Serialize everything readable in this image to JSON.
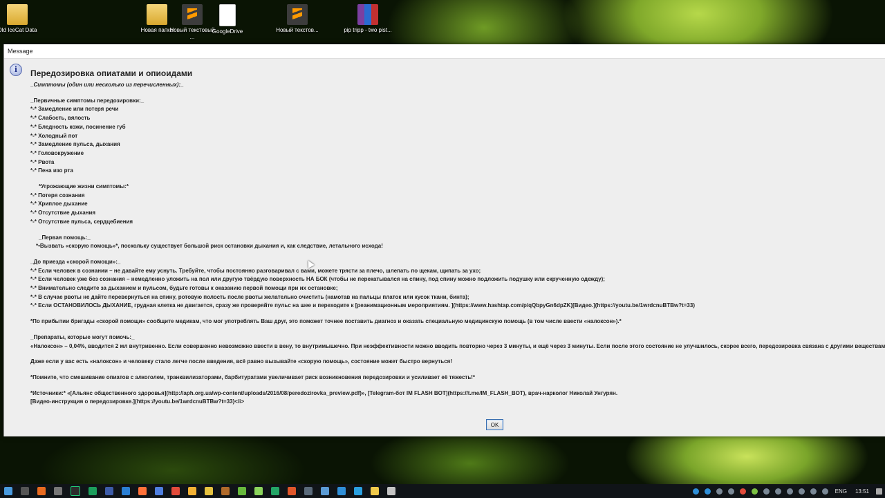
{
  "desktop": {
    "icons": [
      {
        "label": "Old IceCat Data",
        "type": "folder-icon"
      },
      {
        "label": "Новая папка",
        "type": "folder-icon"
      },
      {
        "label": "Новый текстовый ...",
        "type": "sublime-icon"
      },
      {
        "label": "GoogleDrive",
        "type": "document-icon"
      },
      {
        "label": "Новый текстов...",
        "type": "sublime-icon"
      },
      {
        "label": "pip tripp - two pist...",
        "type": "rar-archive-icon"
      }
    ]
  },
  "dialog": {
    "title": "Message",
    "icon": "info-icon",
    "heading": "Передозировка опиатами и опиоидами",
    "lines": [
      "_Симптомы (один или несколько из перечисленных):_",
      "",
      "_Первичные симптомы передозировки:_",
      "*-* Замедление или потеря речи",
      "*-* Слабость, вялость",
      "*-* Бледность кожи, посинение губ",
      "*-* Холодный пот",
      "*-* Замедление пульса, дыхания",
      "*-* Головокружение",
      "*-* Рвота",
      "*-* Пена изо рта",
      "",
      "*Угрожающие жизни симптомы:*",
      "*-* Потеря сознания",
      "*-* Хриплое дыхание",
      "*-* Отсутствие дыхания",
      "*-* Отсутствие пульса, сердцебиения",
      "",
      "_Первая помощь:_",
      "*•Вызвать «скорую помощь»*, поскольку существует большой риск остановки дыхания и, как следствие, летального исхода!",
      "",
      "_До приезда «скорой помощи»:_",
      "*-* Если человек в сознании – не давайте ему уснуть. Требуйте, чтобы постоянно разговаривал с вами, можете трясти за плечо, шлепать по щекам, щипать за ухо;",
      "*-* Если человек уже без сознания – немедленно уложить на пол или другую твёрдую поверхность НА БОК (чтобы не перекатывался на спину, под спину можно подложить подушку или скрученную одежду);",
      "*-* Внимательно следите за дыханием и пульсом, будьте готовы к оказанию первой помощи при их остановке;",
      "*-* В случае рвоты не дайте перевернуться на спину, ротовую полость после рвоты желательно очистить (намотав на пальцы платок или кусок ткани, бинта);",
      "*-* Если ОСТАНОВИЛОСЬ ДЫХАНИЕ, грудная клетка не двигается, сразу же проверяйте пульс на шее и переходите к [реанимационным мероприятиям. ](https://www.hashtap.com/p/qQbpyGn6dpZK)[Видео.](https://youtu.be/1wrdcnuBTBw?t=33)",
      "",
      "*По прибытии бригады «скорой помощи» сообщите медикам, что мог употреблять Ваш друг, это поможет точнее поставить диагноз и оказать специальную медицинскую помощь (в том числе ввести «налоксон»).*",
      "",
      "_Препараты, которые могут помочь:_",
      "«Налоксон» – 0,04%, вводится 2 мл внутривенно. Если совершенно невозможно ввести в вену, то внутримышечно. При неэффективности можно вводить повторно через 3 минуты, и ещё через 3 минуты. Если после этого состояние не улучшилось, скорее всего, передозировка связана с другими веществами (алкоголь",
      "",
      "Даже если у вас есть «налоксон» и человеку стало легче после введения, всё равно вызывайте «скорую помощь», состояние может быстро вернуться!",
      "",
      "*Помните, что смешивание опиатов с алкоголем, транквилизаторами, барбитуратами увеличивает риск возникновения передозировки и усиливает её тяжесть!*",
      "",
      "*Источники:* «[Альянс общественного здоровья](http://aph.org.ua/wp-content/uploads/2016/08/peredozirovka_preview.pdf)», [Telegram-бот IM FLASH BOT](https://t.me/IM_FLASH_BOT), врач-нарколог Николай Унгурян.",
      "[Видео-инструкция о передозировке.](https://youtu.be/1wrdcnuBTBw?t=33)</i>"
    ],
    "ok_label": "OK"
  },
  "taskbar": {
    "language": "ENG",
    "time": "13:51"
  }
}
